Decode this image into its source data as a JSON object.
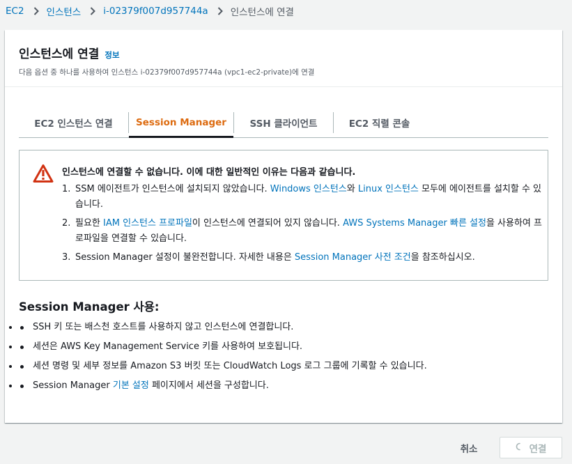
{
  "breadcrumb": {
    "items": [
      "EC2",
      "인스턴스",
      "i-02379f007d957744a"
    ],
    "current": "인스턴스에 연결"
  },
  "header": {
    "title": "인스턴스에 연결",
    "info_link": "정보",
    "subtitle": "다음 옵션 중 하나를 사용하여 인스턴스 i-02379f007d957744a (vpc1-ec2-private)에 연결"
  },
  "tabs": [
    {
      "label": "EC2 인스턴스 연결",
      "active": false
    },
    {
      "label": "Session Manager",
      "active": true
    },
    {
      "label": "SSH 클라이언트",
      "active": false
    },
    {
      "label": "EC2 직렬 콘솔",
      "active": false
    }
  ],
  "alert": {
    "icon": "warning-icon",
    "heading": "인스턴스에 연결할 수 없습니다. 이에 대한 일반적인 이유는 다음과 같습니다.",
    "items": [
      {
        "num": "1.",
        "text_a": "SSM 에이전트가 인스턴스에 설치되지 않았습니다. ",
        "link_a": "Windows 인스턴스",
        "text_b": "와 ",
        "link_b": "Linux 인스턴스",
        "text_c": " 모두에 에이전트를 설치할 수 있습니다."
      },
      {
        "num": "2.",
        "text_a": "필요한 ",
        "link_a": "IAM 인스턴스 프로파일",
        "text_b": "이 인스턴스에 연결되어 있지 않습니다. ",
        "link_b": "AWS Systems Manager 빠른 설정",
        "text_c": "을 사용하여 프로파일을 연결할 수 있습니다."
      },
      {
        "num": "3.",
        "text_a": "Session Manager 설정이 불완전합니다. 자세한 내용은 ",
        "link_a": "Session Manager 사전 조건",
        "text_b": "을 참조하십시오."
      }
    ]
  },
  "usage": {
    "heading": "Session Manager 사용:",
    "items": [
      {
        "text": "SSH 키 또는 배스천 호스트를 사용하지 않고 인스턴스에 연결합니다."
      },
      {
        "text": "세션은 AWS Key Management Service 키를 사용하여 보호됩니다."
      },
      {
        "text": "세션 명령 및 세부 정보를 Amazon S3 버킷 또는 CloudWatch Logs 로그 그룹에 기록할 수 있습니다."
      },
      {
        "pre": "Session Manager ",
        "link": "기본 설정",
        "post": " 페이지에서 세션을 구성합니다."
      }
    ]
  },
  "footer": {
    "cancel_label": "취소",
    "connect_label": "연결",
    "connect_disabled": true
  },
  "colors": {
    "link": "#0073bb",
    "active_tab": "#dd6b10",
    "warning": "#d13212",
    "background": "#f2f3f3"
  }
}
